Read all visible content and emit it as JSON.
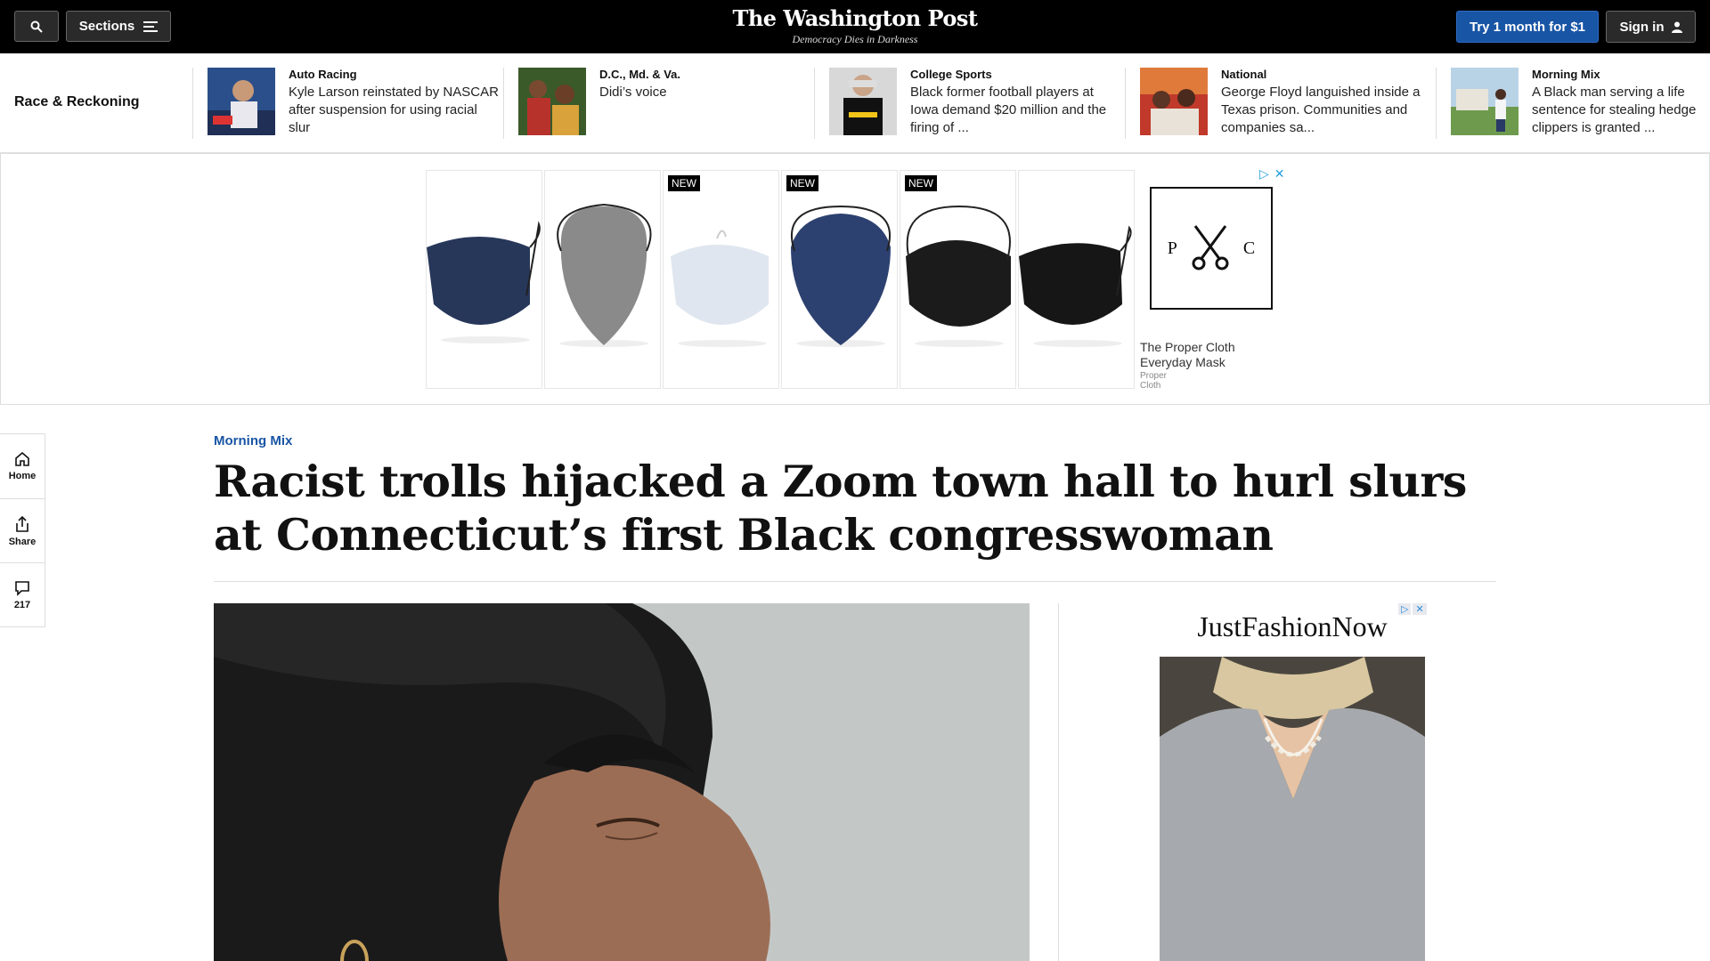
{
  "header": {
    "sections_label": "Sections",
    "logo": "The Washington Post",
    "tagline": "Democracy Dies in Darkness",
    "try_label": "Try 1 month for $1",
    "signin_label": "Sign in"
  },
  "race_strip": {
    "label": "Race & Reckoning",
    "items": [
      {
        "kicker": "Auto Racing",
        "headline": "Kyle Larson reinstated by NASCAR after suspension for using racial slur"
      },
      {
        "kicker": "D.C., Md. & Va.",
        "headline": "Didi’s voice"
      },
      {
        "kicker": "College Sports",
        "headline": "Black former football players at Iowa demand $20 million and the firing of ..."
      },
      {
        "kicker": "National",
        "headline": "George Floyd languished inside a Texas prison. Communities and companies sa..."
      },
      {
        "kicker": "Morning Mix",
        "headline": "A Black man serving a life sentence for stealing hedge clippers is granted ..."
      }
    ]
  },
  "ad_banner": {
    "new_label": "NEW",
    "logo_left": "P",
    "logo_right": "C",
    "title": "The Proper Cloth Everyday Mask",
    "brand": "Proper Cloth",
    "mask_colors": [
      "#27375a",
      "#8a8a8a",
      "#dfe6ef",
      "#2d4170",
      "#1b1b1b",
      "#161616"
    ]
  },
  "rail": {
    "home_label": "Home",
    "share_label": "Share",
    "comments_count": "217"
  },
  "article": {
    "kicker": "Morning Mix",
    "headline": "Racist trolls hijacked a Zoom town hall to hurl slurs at Connecticut’s first Black congresswoman"
  },
  "side_ad": {
    "brand": "JustFashionNow"
  }
}
